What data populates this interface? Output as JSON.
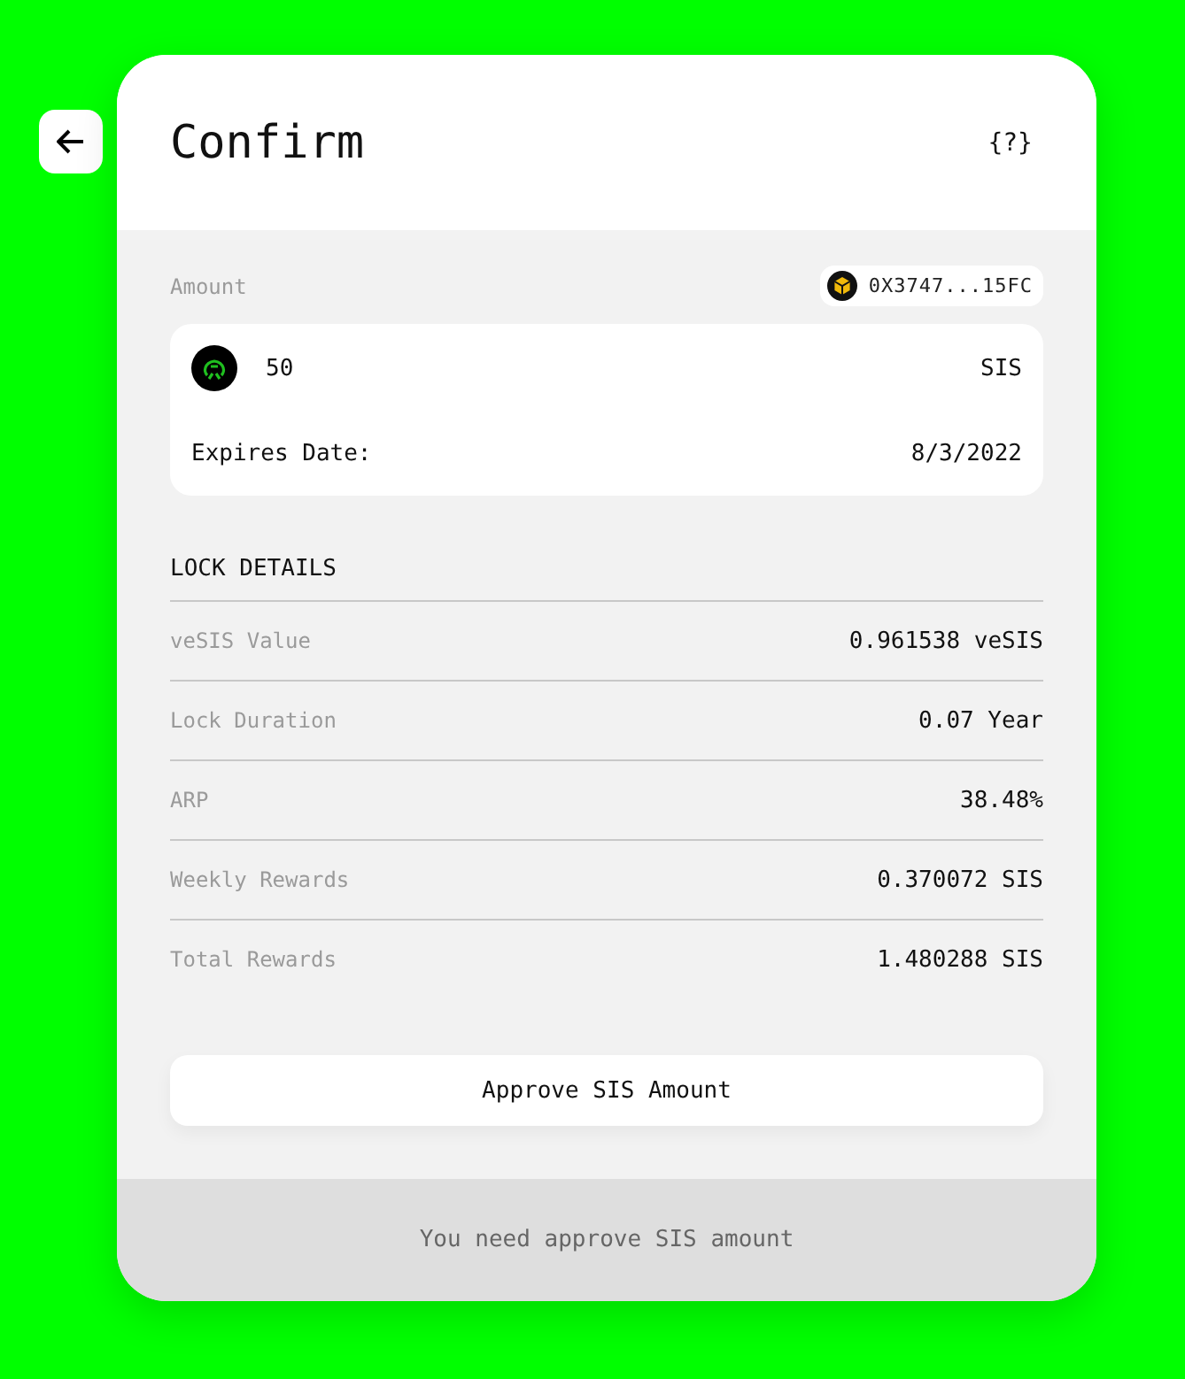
{
  "header": {
    "title": "Confirm",
    "help": "{?}"
  },
  "amount": {
    "label": "Amount",
    "address": "0X3747...15FC",
    "value": "50",
    "token": "SIS",
    "expires_label": "Expires Date:",
    "expires_value": "8/3/2022"
  },
  "lock_details": {
    "title": "LOCK DETAILS",
    "rows": [
      {
        "label": "veSIS Value",
        "value": "0.961538 veSIS"
      },
      {
        "label": "Lock Duration",
        "value": "0.07 Year"
      },
      {
        "label": "ARP",
        "value": "38.48%"
      },
      {
        "label": "Weekly Rewards",
        "value": "0.370072 SIS"
      },
      {
        "label": "Total Rewards",
        "value": "1.480288 SIS"
      }
    ]
  },
  "approve_button": "Approve SIS Amount",
  "footer": "You need approve SIS amount"
}
